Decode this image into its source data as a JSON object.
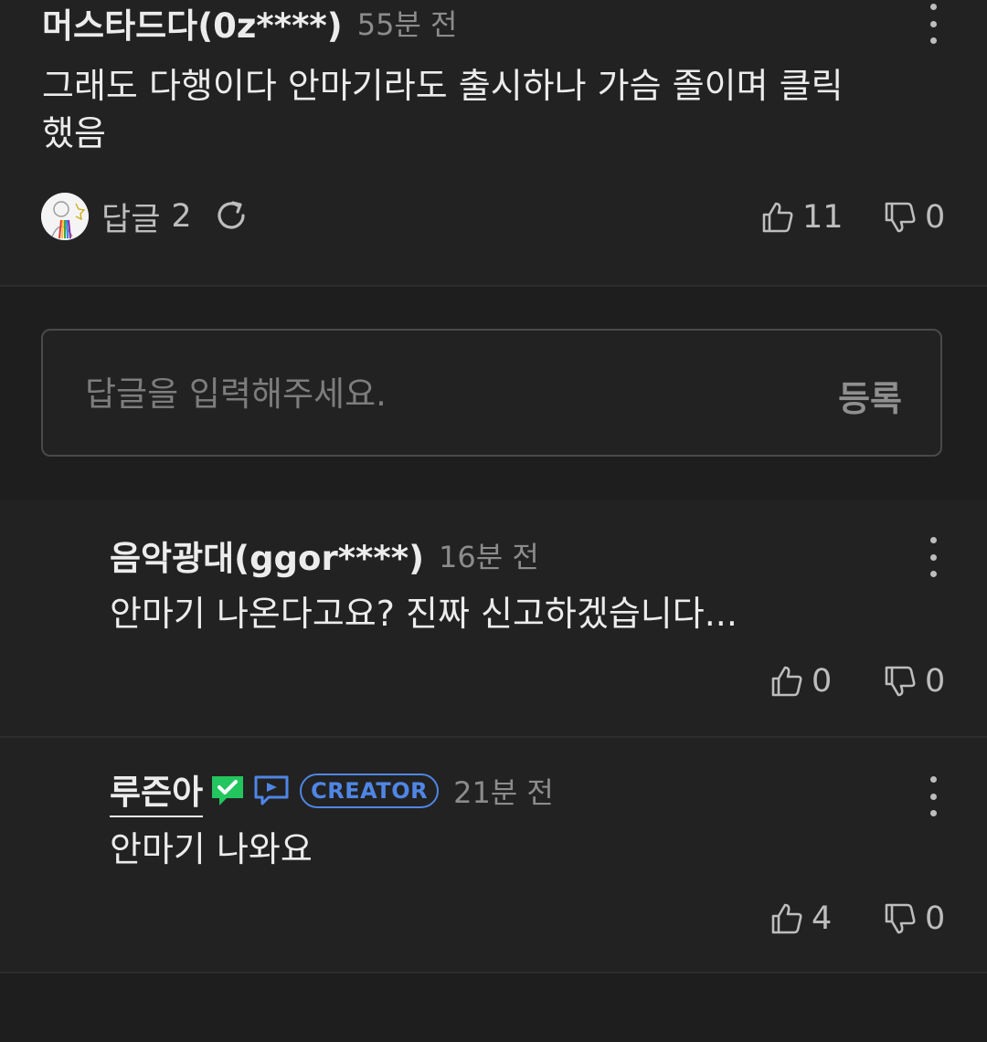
{
  "comments": [
    {
      "author": "머스타드다(0z****)",
      "time": "55분 전",
      "body": "그래도 다행이다 안마기라도 출시하나 가슴 졸이며 클릭",
      "body_cont": "했음",
      "reply_label": "답글",
      "reply_count": "2",
      "likes": "11",
      "dislikes": "0"
    }
  ],
  "reply_input": {
    "placeholder": "답글을 입력해주세요.",
    "submit_label": "등록"
  },
  "replies": [
    {
      "author": "음악광대(ggor****)",
      "time": "16분 전",
      "body": "안마기 나온다고요? 진짜 신고하겠습니다...",
      "likes": "0",
      "dislikes": "0"
    },
    {
      "author": "루즌아",
      "creator_badge": "CREATOR",
      "time": "21분 전",
      "body": "안마기 나와요",
      "likes": "4",
      "dislikes": "0"
    }
  ],
  "colors": {
    "background": "#1e1e1e",
    "card": "#222222",
    "verified_green": "#22c55e",
    "creator_blue": "#4f86e6"
  },
  "icons": [
    "kebab-menu-icon",
    "refresh-icon",
    "thumbs-up-icon",
    "thumbs-down-icon",
    "verified-check-icon",
    "play-channel-icon"
  ]
}
